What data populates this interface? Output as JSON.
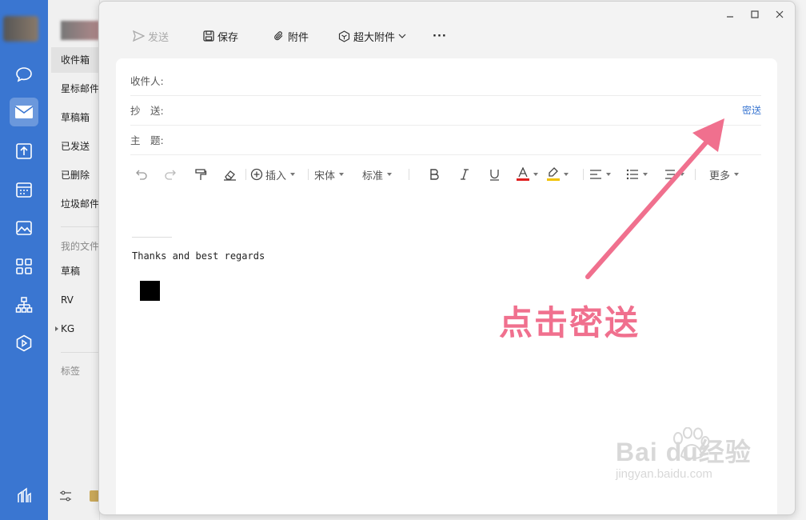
{
  "rail": {
    "icons": [
      "chat-icon",
      "mail-icon",
      "upload-box-icon",
      "calendar-icon",
      "photo-icon",
      "apps-grid-icon",
      "org-chart-icon",
      "play-hex-icon",
      "settings-icon"
    ]
  },
  "folders": {
    "items": [
      "收件箱",
      "星标邮件",
      "草稿箱",
      "已发送",
      "已删除",
      "垃圾邮件"
    ],
    "my_files_label": "我的文件",
    "my_files": [
      "草稿",
      "RV",
      "KG"
    ],
    "tags_label": "标签"
  },
  "compose": {
    "toolbar": {
      "send": "发送",
      "save": "保存",
      "attach": "附件",
      "big_attach": "超大附件",
      "more": "···"
    },
    "to_label": "收件人:",
    "cc_label": "抄　送:",
    "bcc_link": "密送",
    "subject_label": "主　题:",
    "format": {
      "insert": "插入",
      "font": "宋体",
      "size": "标准",
      "more": "更多"
    },
    "signature": "Thanks and best regards"
  },
  "annotation": {
    "text": "点击密送",
    "color": "#f0708e"
  },
  "watermark": {
    "brand": "Bai du经验",
    "url": "jingyan.baidu.com"
  }
}
